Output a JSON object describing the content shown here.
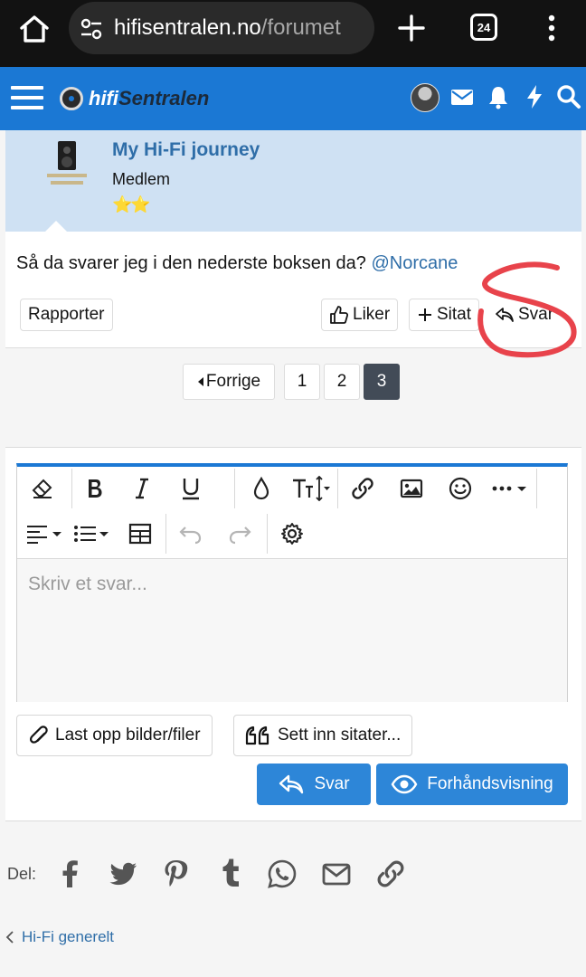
{
  "browser": {
    "url_domain": "hifisentralen.no",
    "url_path": "/forumet",
    "tab_count": "24"
  },
  "site": {
    "logo_part1": "hifi",
    "logo_part2": "Sentralen",
    "header_icons": [
      "menu-icon",
      "avatar",
      "mail-icon",
      "bell-icon",
      "bolt-icon",
      "search-icon"
    ]
  },
  "post": {
    "author": "My Hi-Fi journey",
    "role": "Medlem",
    "stars": "⭐⭐",
    "body": "Så da svarer jeg i den nederste boksen da?",
    "mention": "@Norcane",
    "actions": {
      "report": "Rapporter",
      "like": "Liker",
      "quote": "Sitat",
      "reply": "Svar"
    }
  },
  "pagination": {
    "prev": "Forrige",
    "pages": [
      "1",
      "2",
      "3"
    ],
    "current": "3"
  },
  "editor": {
    "placeholder": "Skriv et svar..."
  },
  "attachments": {
    "upload": "Last opp bilder/filer",
    "insert_quotes": "Sett inn sitater..."
  },
  "submit": {
    "reply": "Svar",
    "preview": "Forhåndsvisning"
  },
  "share": {
    "label": "Del:",
    "icons": [
      "facebook-icon",
      "twitter-icon",
      "pinterest-icon",
      "tumblr-icon",
      "whatsapp-icon",
      "email-icon",
      "link-icon"
    ]
  },
  "breadcrumb": {
    "parent": "Hi-Fi generelt"
  },
  "colors": {
    "brand_blue": "#1b78d4",
    "button_blue": "#2d86d8",
    "userbar": "#cfe1f3",
    "link": "#2f6ea8",
    "annotation": "#e8434b"
  }
}
